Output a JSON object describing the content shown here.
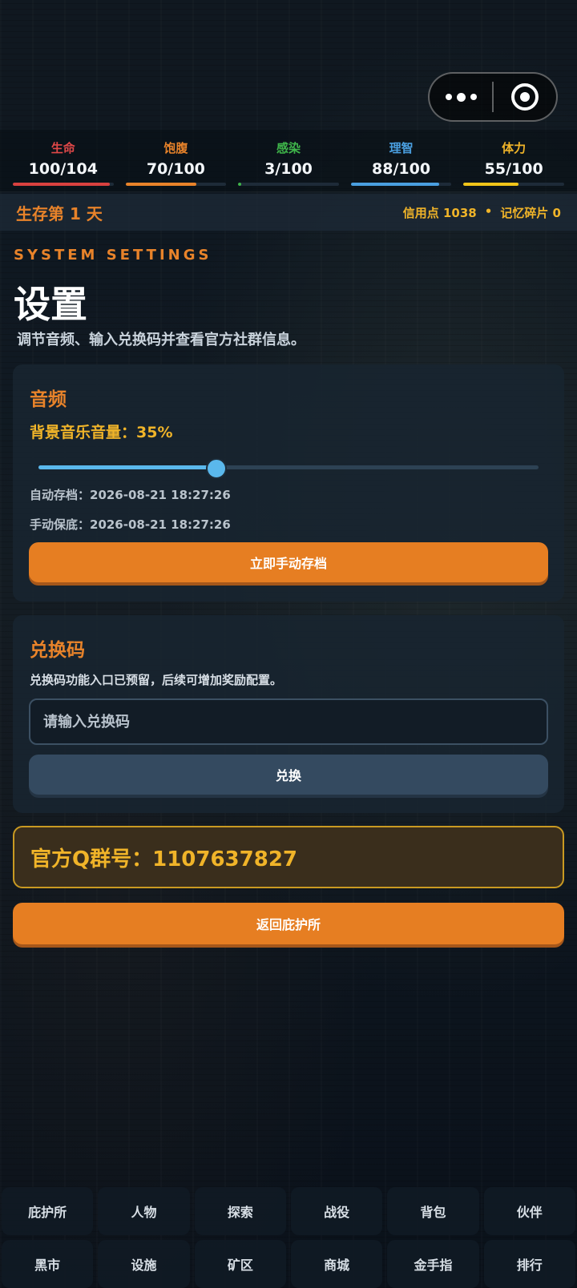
{
  "stats": [
    {
      "label": "生命",
      "value": "100/104",
      "percent": 96,
      "color": "#e04848",
      "bar": "#d9413f"
    },
    {
      "label": "饱腹",
      "value": "70/100",
      "percent": 70,
      "color": "#e8832a",
      "bar": "#e8832a"
    },
    {
      "label": "感染",
      "value": "3/100",
      "percent": 3,
      "color": "#3fb54a",
      "bar": "#3fb54a"
    },
    {
      "label": "理智",
      "value": "88/100",
      "percent": 88,
      "color": "#4a9fe0",
      "bar": "#4a9fe0"
    },
    {
      "label": "体力",
      "value": "55/100",
      "percent": 55,
      "color": "#f0b429",
      "bar": "#f0c419"
    }
  ],
  "day_strip": {
    "day": "生存第 1 天",
    "credits": "信用点 1038",
    "separator": "•",
    "fragments": "记忆碎片 0"
  },
  "header": {
    "kicker": "SYSTEM SETTINGS",
    "title": "设置",
    "subtitle": "调节音频、输入兑换码并查看官方社群信息。"
  },
  "audio": {
    "heading": "音频",
    "volume_label": "背景音乐音量：35%",
    "volume_percent": 35,
    "auto_save": "自动存档：2026-08-21 18:27:26",
    "manual_backup": "手动保底：2026-08-21 18:27:26",
    "save_button": "立即手动存档"
  },
  "redeem": {
    "heading": "兑换码",
    "description": "兑换码功能入口已预留，后续可增加奖励配置。",
    "placeholder": "请输入兑换码",
    "value": "",
    "button": "兑换"
  },
  "community": {
    "qq_group": "官方Q群号：1107637827"
  },
  "back_button": "返回庇护所",
  "nav": {
    "row1": [
      "庇护所",
      "人物",
      "探索",
      "战役",
      "背包",
      "伙伴"
    ],
    "row2": [
      "黑市",
      "设施",
      "矿区",
      "商城",
      "金手指",
      "排行"
    ]
  },
  "colors": {
    "accent": "#e67e22",
    "gold": "#f0b429",
    "slider": "#5ab8ec"
  },
  "icons": [
    "more-icon",
    "close-capsule-icon"
  ]
}
